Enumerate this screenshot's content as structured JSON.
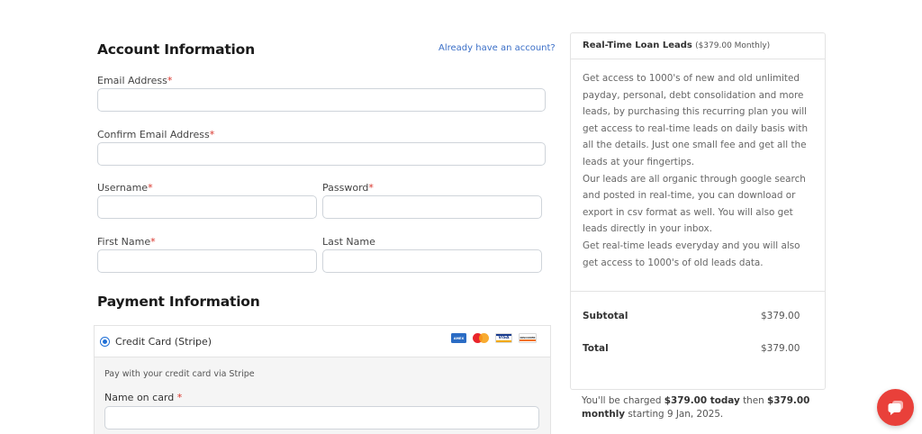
{
  "account": {
    "title": "Account Information",
    "login_link": "Already have an account?",
    "email_label": "Email Address",
    "confirm_email_label": "Confirm Email Address",
    "username_label": "Username",
    "password_label": "Password",
    "first_name_label": "First Name",
    "last_name_label": "Last Name",
    "required_mark": "*"
  },
  "payment": {
    "title": "Payment Information",
    "method_label": "Credit Card (Stripe)",
    "method_selected": true,
    "card_brands": [
      "amex-icon",
      "mastercard-icon",
      "visa-icon",
      "discover-icon"
    ],
    "card_brand_text": {
      "amex": "AMEX",
      "visa": "VISA",
      "discover": "DISCOVER"
    },
    "note": "Pay with your credit card via Stripe",
    "name_on_card_label": "Name on card",
    "required_mark": "*"
  },
  "summary": {
    "product": "Real-Time Loan Leads",
    "price_note": "($379.00 Monthly)",
    "paragraphs": [
      "Get access to 1000's of new and old unlimited payday, personal, debt consolidation and more leads, by purchasing this recurring plan you will get access to real-time leads on daily basis with all the details. Just one small fee and get all the leads at your fingertips.",
      "Our leads are all organic through google search and posted in real-time, you can download or export in csv format as well. You will also get leads directly in your inbox.",
      "Get real-time leads everyday and you will also get access to 1000's of old leads data."
    ],
    "subtotal_label": "Subtotal",
    "subtotal_value": "$379.00",
    "total_label": "Total",
    "total_value": "$379.00",
    "charge_prefix": "You'll be charged",
    "charge_today": "$379.00 today",
    "charge_mid": "then",
    "charge_monthly": "$379.00 monthly",
    "charge_suffix": "starting 9 Jan, 2025."
  },
  "colors": {
    "accent": "#1f6fd6",
    "required": "#d9342b",
    "link": "#3b6fc7",
    "chat": "#e9403a"
  },
  "chat_widget": {
    "icon": "chat-bubble-icon"
  }
}
